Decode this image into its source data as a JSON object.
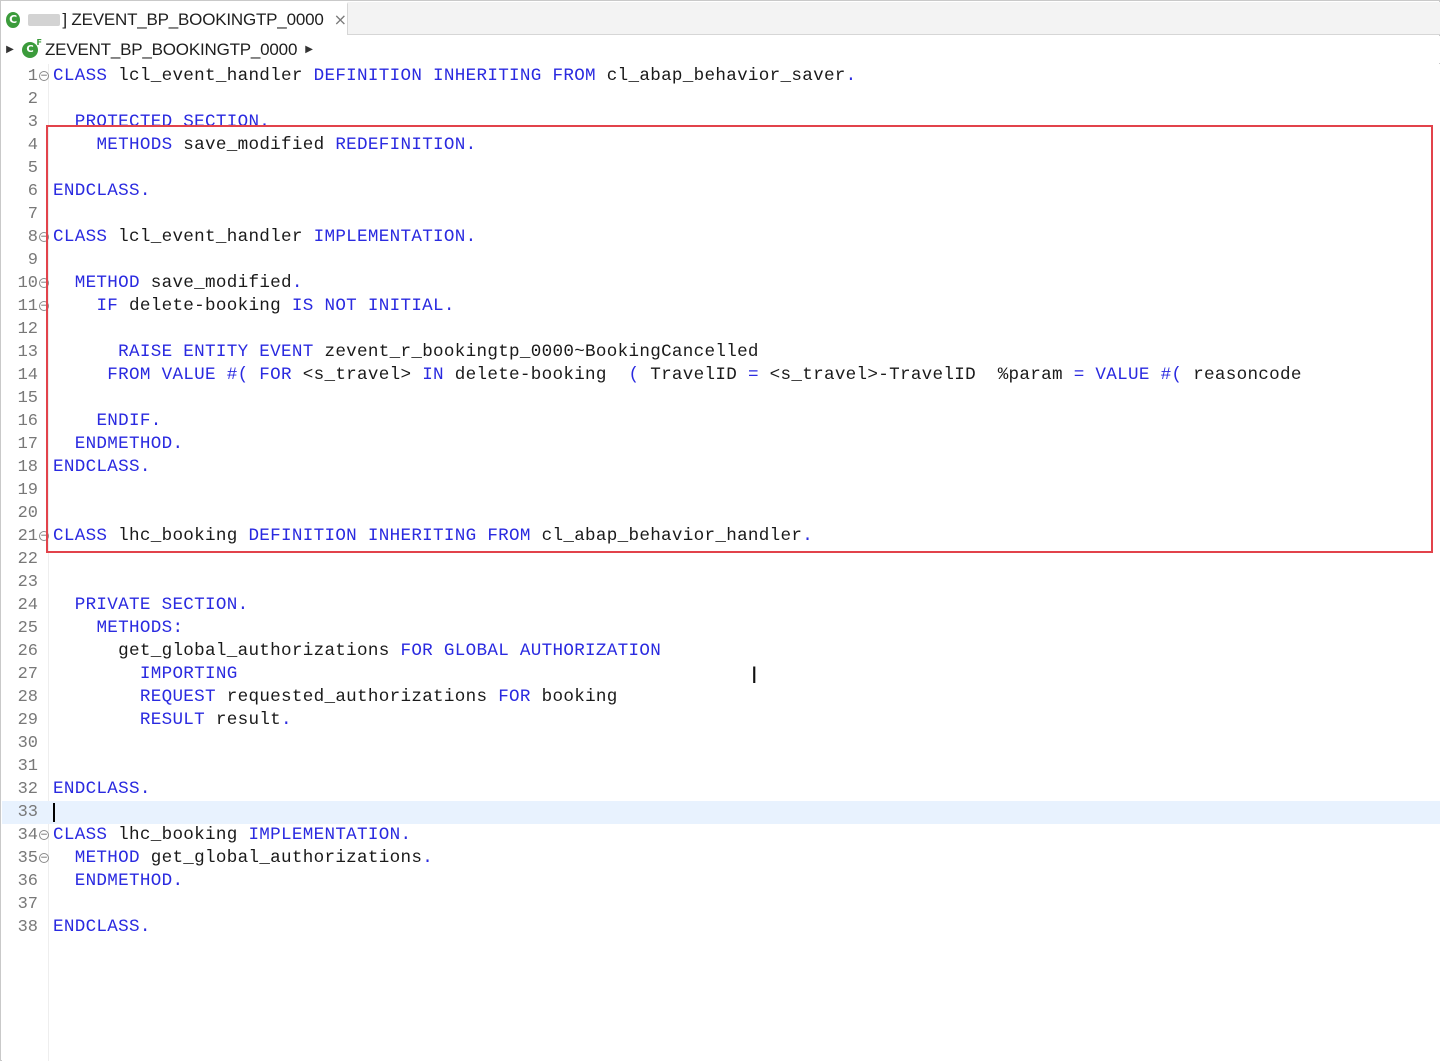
{
  "tab": {
    "icon": "class-icon",
    "system_label_redacted": "",
    "title": "] ZEVENT_BP_BOOKINGTP_0000",
    "close_glyph": "×"
  },
  "breadcrumb": {
    "label": "ZEVENT_BP_BOOKINGTP_0000"
  },
  "editor": {
    "keyword_color": "#2a2ae0",
    "highlight_color": "#e2434b",
    "cursor_line": 33,
    "lines": [
      {
        "n": "1",
        "fold": true,
        "segs": [
          [
            "kw",
            "CLASS"
          ],
          [
            "t",
            " lcl_event_handler "
          ],
          [
            "kw",
            "DEFINITION INHERITING FROM"
          ],
          [
            "t",
            " cl_abap_behavior_saver"
          ],
          [
            "kw",
            "."
          ]
        ]
      },
      {
        "n": "2",
        "fold": false,
        "segs": []
      },
      {
        "n": "3",
        "fold": false,
        "segs": [
          [
            "t",
            "  "
          ],
          [
            "kw",
            "PROTECTED SECTION."
          ]
        ]
      },
      {
        "n": "4",
        "fold": false,
        "segs": [
          [
            "t",
            "    "
          ],
          [
            "kw",
            "METHODS"
          ],
          [
            "t",
            " save_modified "
          ],
          [
            "kw",
            "REDEFINITION."
          ]
        ]
      },
      {
        "n": "5",
        "fold": false,
        "segs": []
      },
      {
        "n": "6",
        "fold": false,
        "segs": [
          [
            "kw",
            "ENDCLASS."
          ]
        ]
      },
      {
        "n": "7",
        "fold": false,
        "segs": []
      },
      {
        "n": "8",
        "fold": true,
        "segs": [
          [
            "kw",
            "CLASS"
          ],
          [
            "t",
            " lcl_event_handler "
          ],
          [
            "kw",
            "IMPLEMENTATION."
          ]
        ]
      },
      {
        "n": "9",
        "fold": false,
        "segs": []
      },
      {
        "n": "10",
        "fold": true,
        "segs": [
          [
            "t",
            "  "
          ],
          [
            "kw",
            "METHOD"
          ],
          [
            "t",
            " save_modified"
          ],
          [
            "kw",
            "."
          ]
        ]
      },
      {
        "n": "11",
        "fold": true,
        "segs": [
          [
            "t",
            "    "
          ],
          [
            "kw",
            "IF"
          ],
          [
            "t",
            " delete-booking "
          ],
          [
            "kw",
            "IS NOT INITIAL."
          ]
        ]
      },
      {
        "n": "12",
        "fold": false,
        "segs": []
      },
      {
        "n": "13",
        "fold": false,
        "segs": [
          [
            "t",
            "      "
          ],
          [
            "kw",
            "RAISE ENTITY EVENT"
          ],
          [
            "t",
            " zevent_r_bookingtp_0000~BookingCancelled"
          ]
        ]
      },
      {
        "n": "14",
        "fold": false,
        "segs": [
          [
            "t",
            "     "
          ],
          [
            "kw",
            "FROM VALUE #( FOR"
          ],
          [
            "t",
            " <s_travel> "
          ],
          [
            "kw",
            "IN"
          ],
          [
            "t",
            " delete-booking  "
          ],
          [
            "kw",
            "("
          ],
          [
            "t",
            " TravelID "
          ],
          [
            "kw",
            "="
          ],
          [
            "t",
            " <s_travel>-TravelID  %param "
          ],
          [
            "kw",
            "= VALUE #("
          ],
          [
            "t",
            " reasoncode"
          ]
        ]
      },
      {
        "n": "15",
        "fold": false,
        "segs": []
      },
      {
        "n": "16",
        "fold": false,
        "segs": [
          [
            "t",
            "    "
          ],
          [
            "kw",
            "ENDIF."
          ]
        ]
      },
      {
        "n": "17",
        "fold": false,
        "segs": [
          [
            "t",
            "  "
          ],
          [
            "kw",
            "ENDMETHOD."
          ]
        ]
      },
      {
        "n": "18",
        "fold": false,
        "segs": [
          [
            "kw",
            "ENDCLASS."
          ]
        ]
      },
      {
        "n": "19",
        "fold": false,
        "segs": []
      },
      {
        "n": "20",
        "fold": false,
        "segs": []
      },
      {
        "n": "21",
        "fold": true,
        "segs": [
          [
            "kw",
            "CLASS"
          ],
          [
            "t",
            " lhc_booking "
          ],
          [
            "kw",
            "DEFINITION INHERITING FROM"
          ],
          [
            "t",
            " cl_abap_behavior_handler"
          ],
          [
            "kw",
            "."
          ]
        ]
      },
      {
        "n": "22",
        "fold": false,
        "segs": []
      },
      {
        "n": "23",
        "fold": false,
        "segs": []
      },
      {
        "n": "24",
        "fold": false,
        "segs": [
          [
            "t",
            "  "
          ],
          [
            "kw",
            "PRIVATE SECTION."
          ]
        ]
      },
      {
        "n": "25",
        "fold": false,
        "segs": [
          [
            "t",
            "    "
          ],
          [
            "kw",
            "METHODS:"
          ]
        ]
      },
      {
        "n": "26",
        "fold": false,
        "segs": [
          [
            "t",
            "      get_global_authorizations "
          ],
          [
            "kw",
            "FOR GLOBAL AUTHORIZATION"
          ]
        ]
      },
      {
        "n": "27",
        "fold": false,
        "segs": [
          [
            "t",
            "        "
          ],
          [
            "kw",
            "IMPORTING"
          ]
        ]
      },
      {
        "n": "28",
        "fold": false,
        "segs": [
          [
            "t",
            "        "
          ],
          [
            "kw",
            "REQUEST"
          ],
          [
            "t",
            " requested_authorizations "
          ],
          [
            "kw",
            "FOR"
          ],
          [
            "t",
            " booking"
          ]
        ]
      },
      {
        "n": "29",
        "fold": false,
        "segs": [
          [
            "t",
            "        "
          ],
          [
            "kw",
            "RESULT"
          ],
          [
            "t",
            " result"
          ],
          [
            "kw",
            "."
          ]
        ]
      },
      {
        "n": "30",
        "fold": false,
        "segs": []
      },
      {
        "n": "31",
        "fold": false,
        "segs": []
      },
      {
        "n": "32",
        "fold": false,
        "segs": [
          [
            "kw",
            "ENDCLASS."
          ]
        ]
      },
      {
        "n": "33",
        "fold": false,
        "segs": []
      },
      {
        "n": "34",
        "fold": true,
        "segs": [
          [
            "kw",
            "CLASS"
          ],
          [
            "t",
            " lhc_booking "
          ],
          [
            "kw",
            "IMPLEMENTATION."
          ]
        ]
      },
      {
        "n": "35",
        "fold": true,
        "segs": [
          [
            "t",
            "  "
          ],
          [
            "kw",
            "METHOD"
          ],
          [
            "t",
            " get_global_authorizations"
          ],
          [
            "kw",
            "."
          ]
        ]
      },
      {
        "n": "36",
        "fold": false,
        "segs": [
          [
            "t",
            "  "
          ],
          [
            "kw",
            "ENDMETHOD."
          ]
        ]
      },
      {
        "n": "37",
        "fold": false,
        "segs": []
      },
      {
        "n": "38",
        "fold": false,
        "segs": [
          [
            "kw",
            "ENDCLASS."
          ]
        ]
      }
    ]
  }
}
